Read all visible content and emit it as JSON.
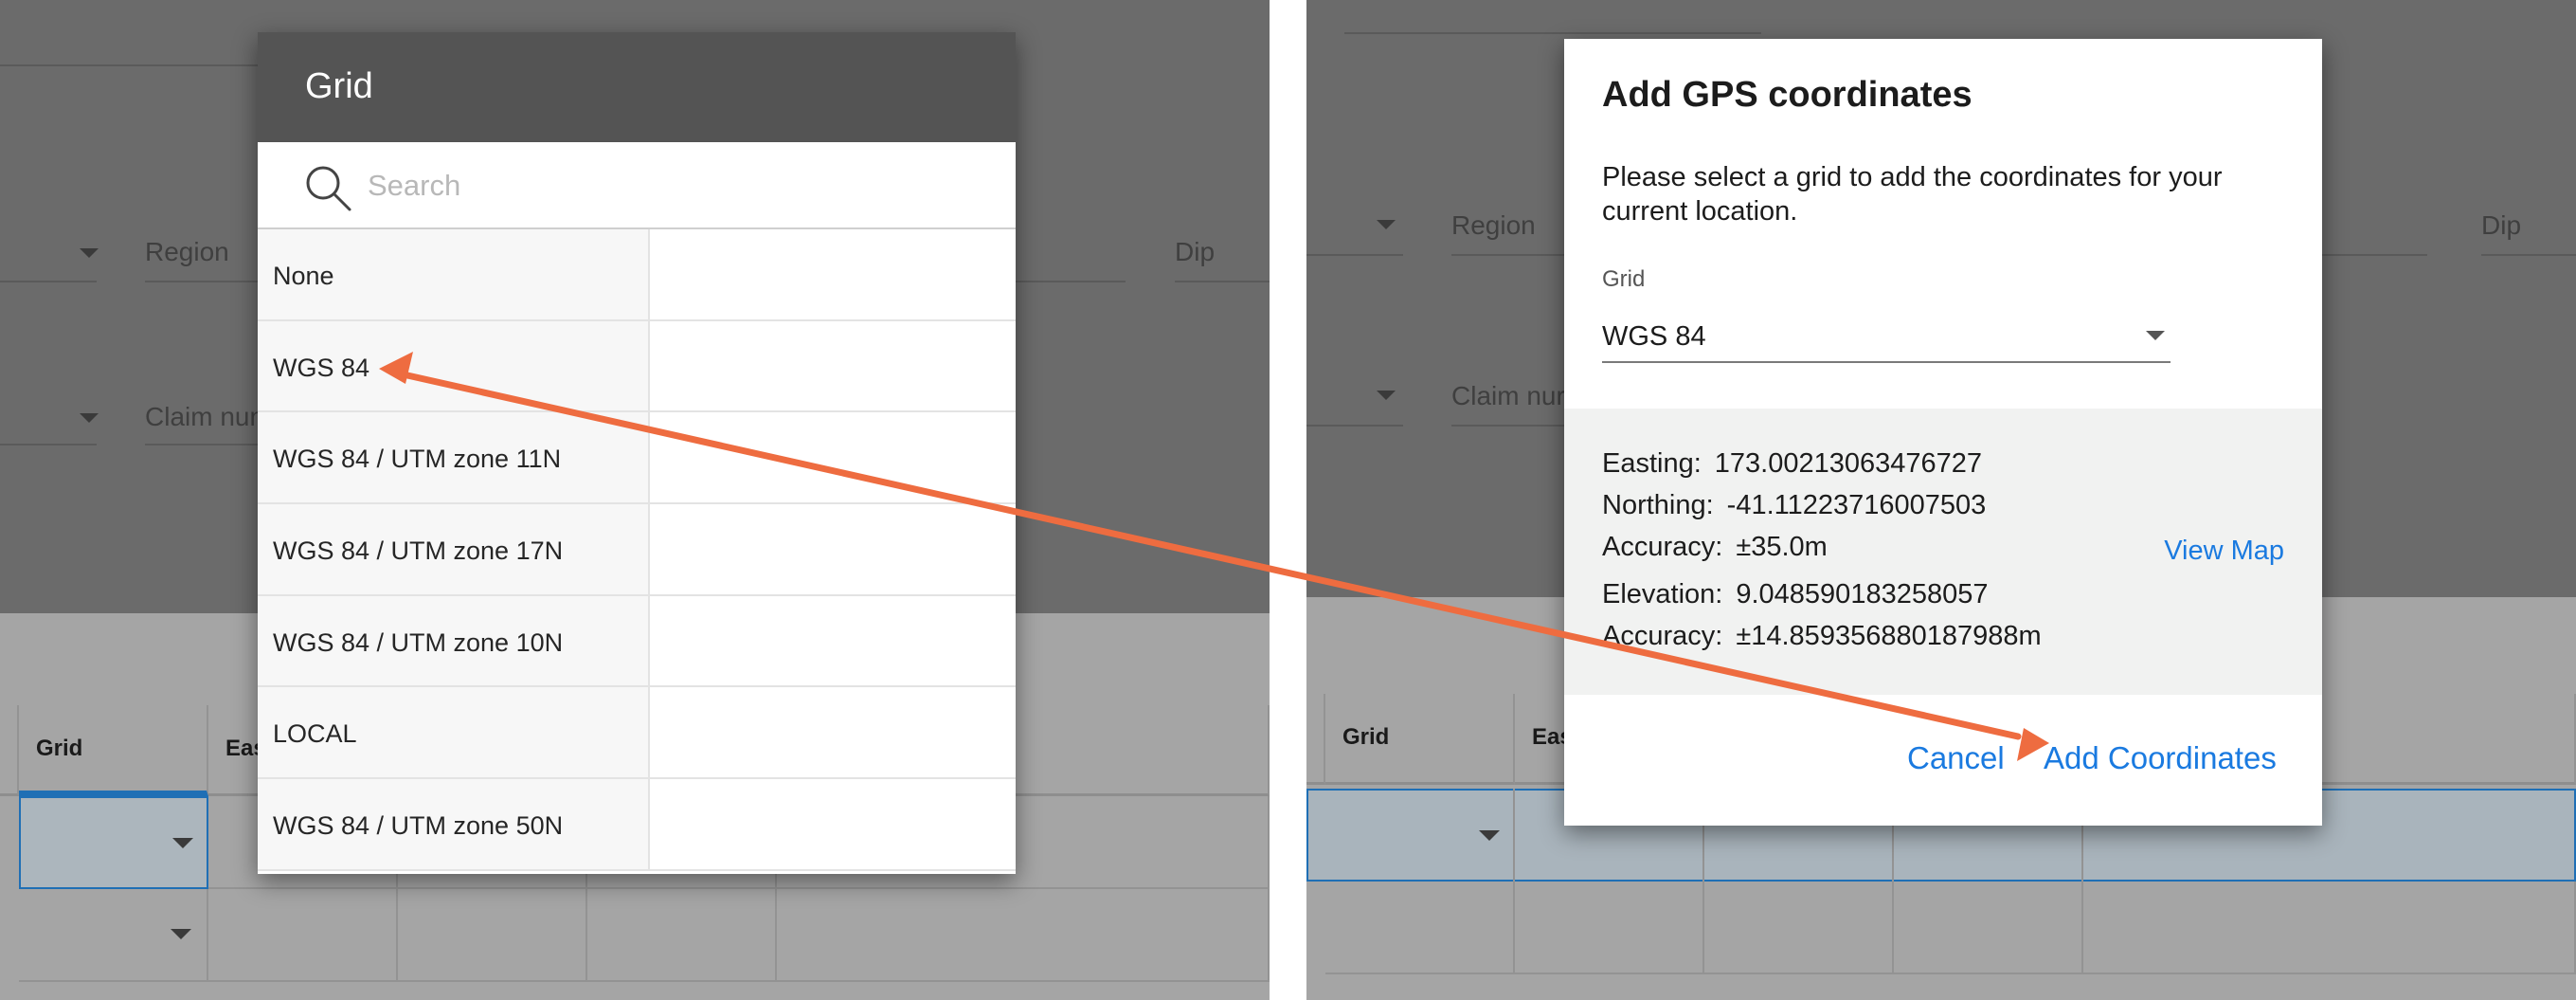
{
  "left": {
    "background": {
      "region_label": "Region",
      "dip_label": "Dip",
      "claim_label": "Claim nun",
      "table_headers": [
        "Grid",
        "Eas"
      ]
    },
    "picker": {
      "title": "Grid",
      "search_placeholder": "Search",
      "items": [
        "None",
        "WGS 84",
        "WGS 84 / UTM zone 11N",
        "WGS 84 / UTM zone 17N",
        "WGS 84 / UTM zone 10N",
        "LOCAL",
        "WGS 84 / UTM zone 50N"
      ]
    }
  },
  "right": {
    "background": {
      "region_label": "Region",
      "dip_label": "Dip",
      "claim_label": "Claim nur",
      "table_headers": [
        "Grid",
        "Eas"
      ]
    },
    "dialog": {
      "title": "Add GPS coordinates",
      "description": "Please select a grid to add the coordinates for your current location.",
      "grid_label": "Grid",
      "grid_value": "WGS 84",
      "easting_label": "Easting:",
      "easting_value": "173.00213063476727",
      "northing_label": "Northing:",
      "northing_value": "-41.11223716007503",
      "accuracy_label": "Accuracy:",
      "accuracy_value": "±35.0m",
      "elevation_label": "Elevation:",
      "elevation_value": "9.048590183258057",
      "elev_accuracy_label": "Accuracy:",
      "elev_accuracy_value": "±14.859356880187988m",
      "view_map": "View Map",
      "cancel": "Cancel",
      "add": "Add Coordinates"
    }
  },
  "colors": {
    "accent": "#1a7ae0",
    "annotation_arrow": "#ee6c40",
    "picker_header": "#545454",
    "overlay_dark": "#6b6b6b",
    "overlay_light": "#a5a5a5"
  }
}
